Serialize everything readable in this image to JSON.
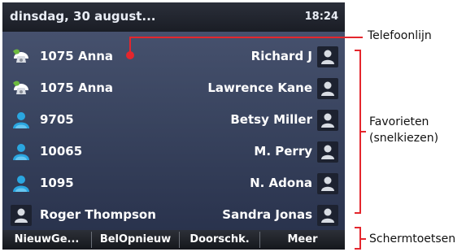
{
  "header": {
    "date": "dinsdag, 30 august...",
    "time": "18:24"
  },
  "rows": [
    {
      "left_icon": "phone-line-icon",
      "left_label": "1075 Anna",
      "right_label": "Richard J",
      "right_icon": "contact-icon"
    },
    {
      "left_icon": "phone-line-icon",
      "left_label": "1075 Anna",
      "right_label": "Lawrence Kane",
      "right_icon": "contact-icon"
    },
    {
      "left_icon": "favorite-person-icon",
      "left_label": "9705",
      "right_label": "Betsy Miller",
      "right_icon": "contact-icon"
    },
    {
      "left_icon": "favorite-person-icon",
      "left_label": "10065",
      "right_label": "M. Perry",
      "right_icon": "contact-icon"
    },
    {
      "left_icon": "favorite-person-icon",
      "left_label": "1095",
      "right_label": "N. Adona",
      "right_icon": "contact-icon"
    },
    {
      "left_icon": "contact-icon",
      "left_label": "Roger Thompson",
      "right_label": "Sandra Jonas",
      "right_icon": "contact-icon"
    }
  ],
  "softkeys": [
    "NieuwGe...",
    "BelOpnieuw",
    "Doorschk.",
    "Meer"
  ],
  "callouts": {
    "phone_line": "Telefoonlijn",
    "favorites_line1": "Favorieten",
    "favorites_line2": "(snelkiezen)",
    "softkeys": "Schermtoetsen"
  },
  "colors": {
    "callout_accent": "#e4262d",
    "favorite_icon": "#2aa6e0",
    "handset_green": "#6dbb3f"
  }
}
